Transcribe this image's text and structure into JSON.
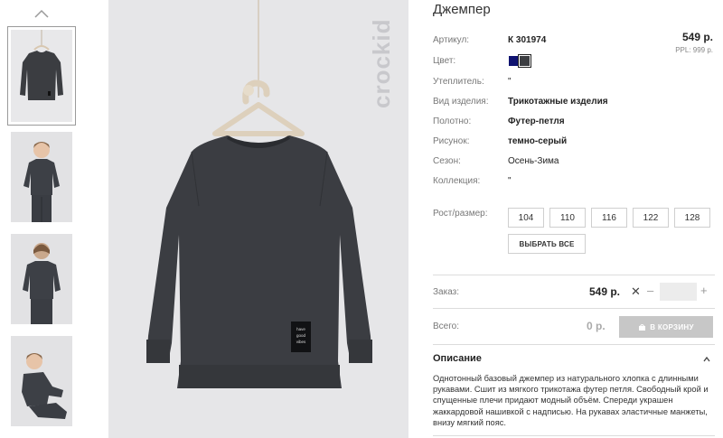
{
  "product": {
    "title": "Джемпер",
    "price": "549 р.",
    "rrp": "PPL: 999 р.",
    "attributes": [
      {
        "label": "Артикул:",
        "value": "К 301974",
        "bold": true
      },
      {
        "label": "Цвет:",
        "value": "",
        "bold": false
      },
      {
        "label": "Утеплитель:",
        "value": "\"",
        "bold": false
      },
      {
        "label": "Вид изделия:",
        "value": "Трикотажные изделия",
        "bold": true
      },
      {
        "label": "Полотно:",
        "value": "Футер-петля",
        "bold": true
      },
      {
        "label": "Рисунок:",
        "value": "темно-серый",
        "bold": true
      },
      {
        "label": "Сезон:",
        "value": "Осень-Зима",
        "bold": false
      },
      {
        "label": "Коллекция:",
        "value": "\"",
        "bold": false
      }
    ],
    "colors": [
      "#0f1270",
      "#3c3e42"
    ]
  },
  "brand": "crockid",
  "sizes": {
    "label": "Рост/размер:",
    "options": [
      "104",
      "110",
      "116",
      "122",
      "128"
    ],
    "select_all": "ВЫБРАТЬ ВСЕ"
  },
  "order": {
    "label": "Заказ:",
    "price": "549 р.",
    "times": "✕",
    "minus": "–",
    "plus": "+",
    "qty_value": ""
  },
  "total": {
    "label": "Всего:",
    "price": "0 р.",
    "cart_button": "В КОРЗИНУ"
  },
  "description": {
    "title": "Описание",
    "text": "Однотонный базовый джемпер из натурального хлопка с длинными рукавами. Сшит из мягкого трикотажа футер петля. Свободный крой и спущенные плечи придают модный объём. Спереди украшен жаккардовой нашивкой с надписью. На рукавах эластичные манжеты, внизу мягкий пояс."
  },
  "patch_text": [
    "have",
    "good",
    "vibes"
  ]
}
